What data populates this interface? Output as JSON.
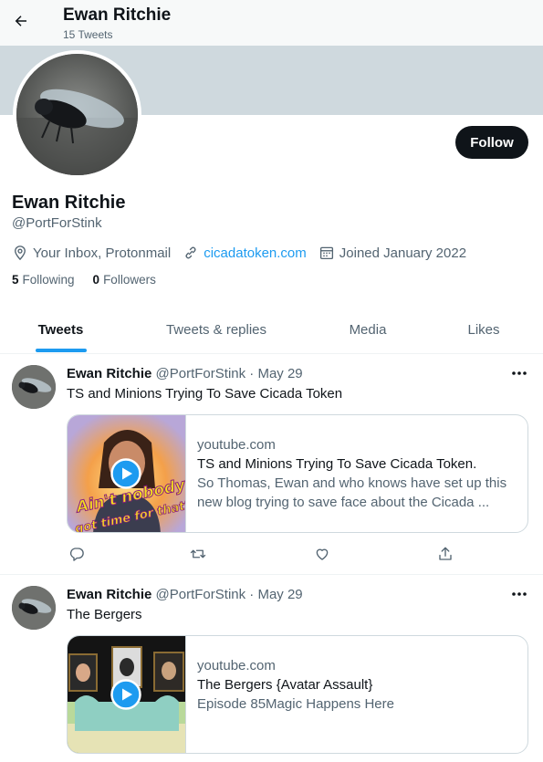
{
  "header": {
    "name": "Ewan Ritchie",
    "tweet_count": "15 Tweets"
  },
  "profile": {
    "name": "Ewan Ritchie",
    "handle": "@PortForStink",
    "follow_label": "Follow",
    "location": "Your Inbox, Protonmail",
    "website": "cicadatoken.com",
    "joined": "Joined January 2022",
    "following_count": "5",
    "following_label": "Following",
    "followers_count": "0",
    "followers_label": "Followers"
  },
  "tabs": [
    {
      "label": "Tweets",
      "active": true
    },
    {
      "label": "Tweets & replies"
    },
    {
      "label": "Media"
    },
    {
      "label": "Likes"
    }
  ],
  "tweets": [
    {
      "name": "Ewan Ritchie",
      "meta": "@PortForStink · May 29",
      "text": "TS and Minions Trying To Save Cicada Token",
      "card": {
        "domain": "youtube.com",
        "title": "TS and Minions Trying To Save Cicada Token.",
        "description": "So Thomas, Ewan and who knows have set up this new blog trying to save face about the Cicada ...",
        "thumb_caption": "Ain't nobody got time for that?"
      }
    },
    {
      "name": "Ewan Ritchie",
      "meta": "@PortForStink · May 29",
      "text": "The Bergers",
      "card": {
        "domain": "youtube.com",
        "title": "The Bergers {Avatar Assault}",
        "description": "Episode 85Magic Happens Here"
      }
    }
  ],
  "icons": {
    "back": "arrow-left-icon",
    "location": "location-pin-icon",
    "link": "link-icon",
    "calendar": "calendar-icon",
    "more": "more-dots-icon",
    "reply": "reply-icon",
    "retweet": "retweet-icon",
    "like": "heart-icon",
    "share": "share-icon",
    "play": "play-icon"
  },
  "colors": {
    "accent": "#1d9bf0",
    "text": "#0f1419",
    "muted": "#536471",
    "banner": "#cfd9de",
    "button": "#0f1419"
  }
}
